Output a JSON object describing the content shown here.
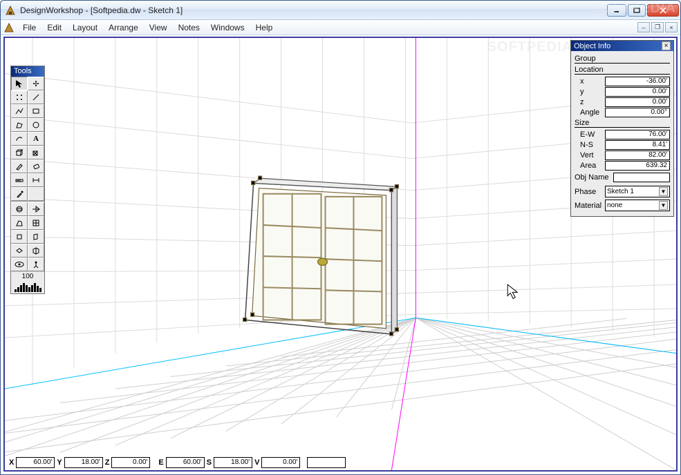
{
  "window": {
    "title": "DesignWorkshop - [Softpedia.dw - Sketch 1]"
  },
  "menu": {
    "items": [
      "File",
      "Edit",
      "Layout",
      "Arrange",
      "View",
      "Notes",
      "Windows",
      "Help"
    ]
  },
  "tools_palette": {
    "title": "Tools",
    "zoom_value": "100"
  },
  "object_info": {
    "title": "Object Info",
    "type": "Group",
    "location_label": "Location",
    "x_label": "x",
    "x_value": "-36.00'",
    "y_label": "y",
    "y_value": "0.00'",
    "z_label": "z",
    "z_value": "0.00'",
    "angle_label": "Angle",
    "angle_value": "0.00°",
    "size_label": "Size",
    "ew_label": "E-W",
    "ew_value": "76.00'",
    "ns_label": "N-S",
    "ns_value": "8.41'",
    "vert_label": "Vert",
    "vert_value": "82.00'",
    "area_label": "Area",
    "area_value": "639.32",
    "objname_label": "Obj Name",
    "objname_value": "",
    "phase_label": "Phase",
    "phase_value": "Sketch 1",
    "material_label": "Material",
    "material_value": "none"
  },
  "status": {
    "X": "60.00'",
    "Y": "18.00'",
    "Z": "0.00'",
    "E": "60.00'",
    "S": "18.00'",
    "V": "0.00'",
    "extra": ""
  },
  "watermark": "SOFTPEDIA"
}
